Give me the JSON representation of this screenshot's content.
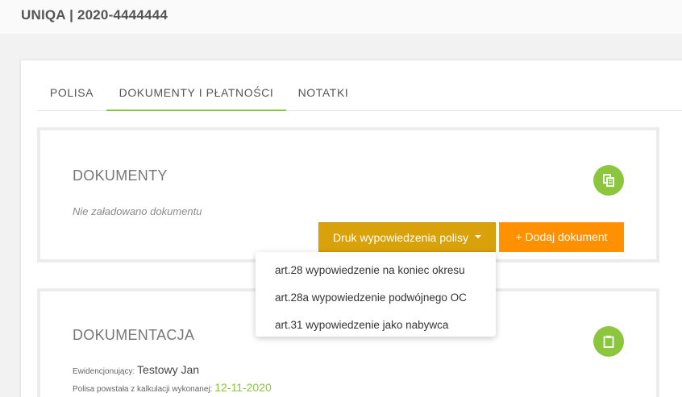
{
  "header": {
    "title": "UNIQA | 2020-4444444"
  },
  "tabs": [
    {
      "label": "POLISA",
      "active": false
    },
    {
      "label": "DOKUMENTY I PŁATNOŚCI",
      "active": true
    },
    {
      "label": "NOTATKI",
      "active": false
    }
  ],
  "documents": {
    "title": "DOKUMENTY",
    "empty_text": "Nie załadowano dokumentu",
    "copy_icon": "copy-icon",
    "print_button_label": "Druk wypowiedzenia polisy",
    "add_button_label": "+ Dodaj dokument",
    "print_menu": [
      "art.28 wypowiedzenie na koniec okresu",
      "art.28a wypowiedzenie podwójnego OC",
      "art.31 wypowiedzenie jako nabywca"
    ]
  },
  "documentation": {
    "title": "DOKUMENTACJA",
    "clipboard_icon": "clipboard-icon",
    "registrar_label": "Ewidencjonujący:",
    "registrar_value": "Testowy Jan",
    "created_label": "Polisa powstała z kalkulacji wykonanej:",
    "created_value": "12-11-2020"
  },
  "colors": {
    "accent_green": "#8cc63f",
    "print_button": "#d9a20b",
    "add_button": "#ff9100"
  }
}
